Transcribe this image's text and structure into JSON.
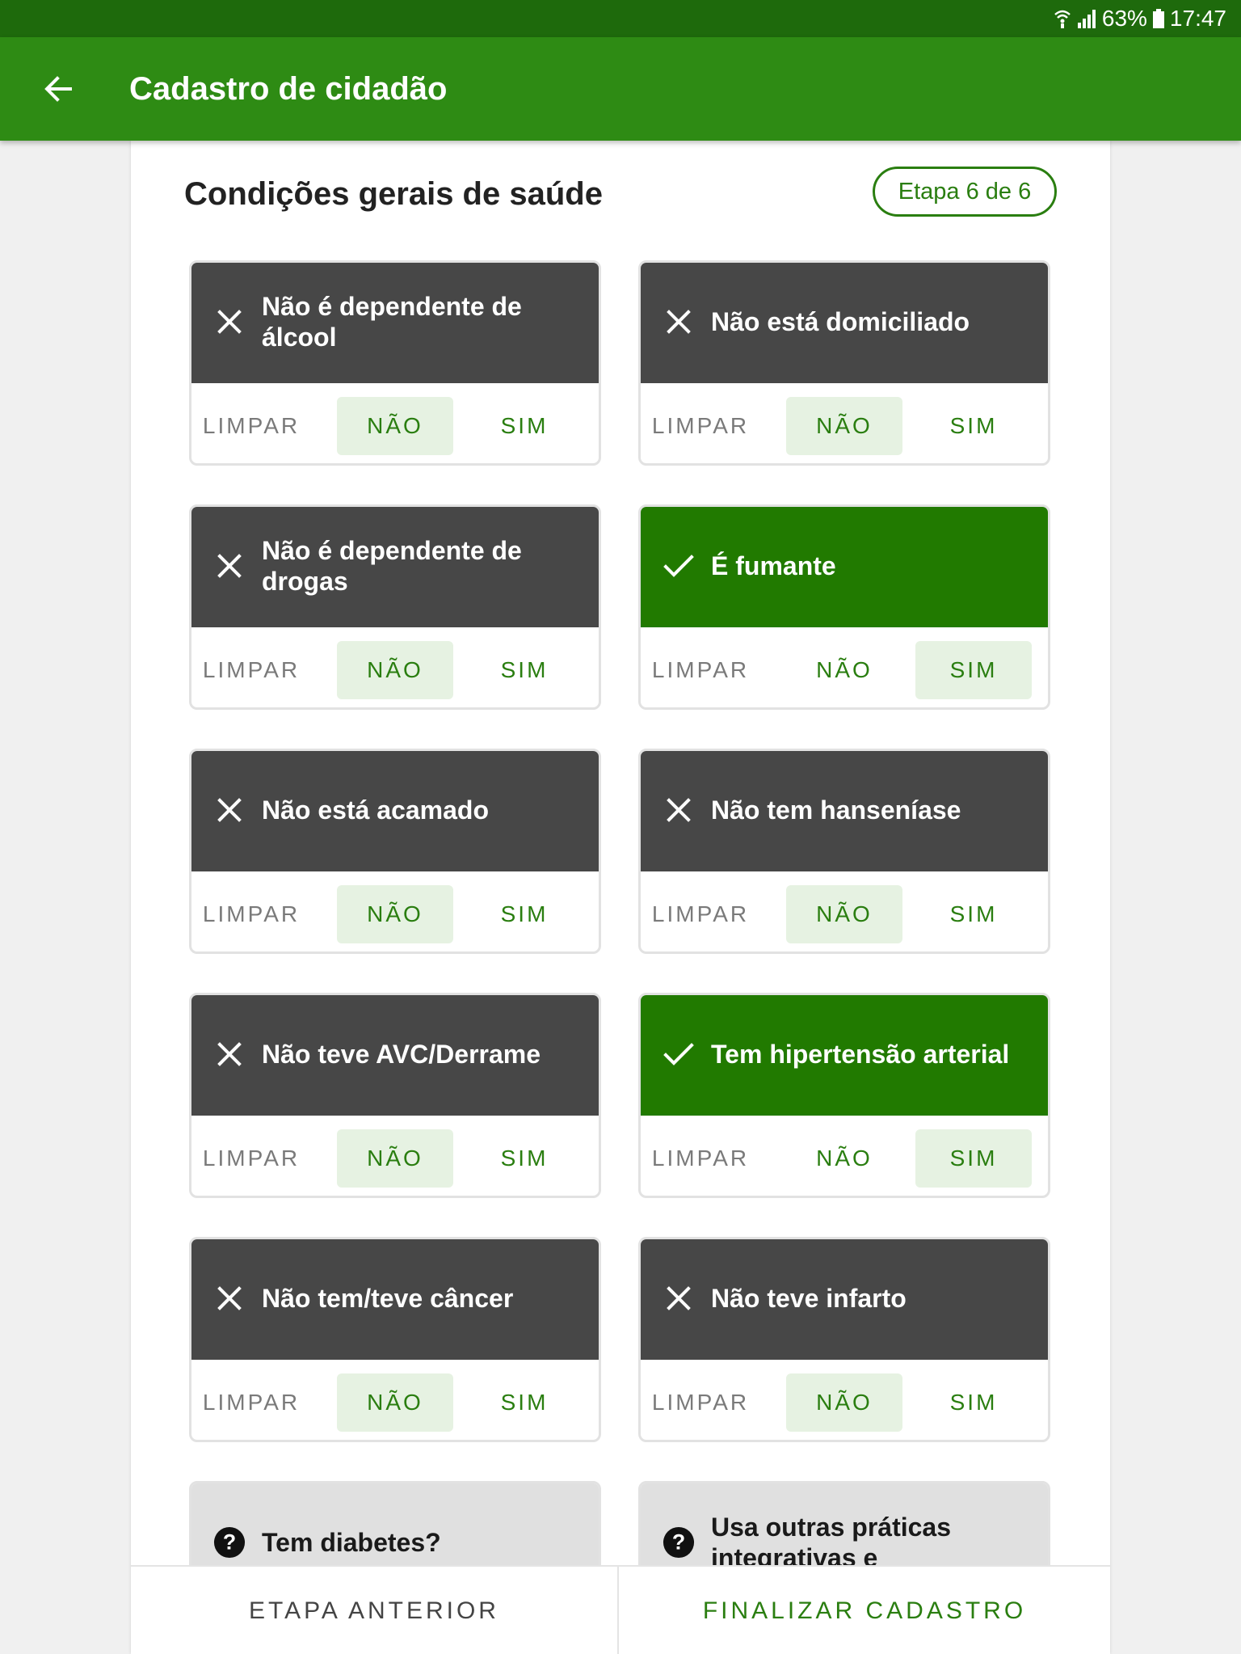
{
  "status_bar": {
    "battery": "63%",
    "time": "17:47"
  },
  "app_bar": {
    "title": "Cadastro de cidadão"
  },
  "section": {
    "title": "Condições gerais de saúde",
    "step": "Etapa 6 de 6"
  },
  "options": {
    "limpar": "LIMPAR",
    "nao": "NÃO",
    "sim": "SIM"
  },
  "cards": [
    {
      "label": "Não é dependente de álcool",
      "icon": "close-icon",
      "selected": "NÃO"
    },
    {
      "label": "Não está domiciliado",
      "icon": "close-icon",
      "selected": "NÃO"
    },
    {
      "label": "Não é dependente de drogas",
      "icon": "close-icon",
      "selected": "NÃO"
    },
    {
      "label": "É fumante",
      "icon": "check-icon",
      "selected": "SIM"
    },
    {
      "label": "Não está acamado",
      "icon": "close-icon",
      "selected": "NÃO"
    },
    {
      "label": "Não tem hanseníase",
      "icon": "close-icon",
      "selected": "NÃO"
    },
    {
      "label": "Não teve AVC/Derrame",
      "icon": "close-icon",
      "selected": "NÃO"
    },
    {
      "label": "Tem hipertensão arterial",
      "icon": "check-icon",
      "selected": "SIM"
    },
    {
      "label": "Não tem/teve câncer",
      "icon": "close-icon",
      "selected": "NÃO"
    },
    {
      "label": "Não teve infarto",
      "icon": "close-icon",
      "selected": "NÃO"
    },
    {
      "label": "Tem diabetes?",
      "icon": "help-icon",
      "selected": ""
    },
    {
      "label": "Usa outras práticas integrativas e",
      "icon": "help-icon",
      "selected": ""
    }
  ],
  "bottom": {
    "prev": "ETAPA ANTERIOR",
    "next": "FINALIZAR CADASTRO"
  },
  "colors": {
    "status_bar": "#1e6a0c",
    "app_bar": "#2e8b14",
    "negative": "#474747",
    "positive": "#217a00",
    "unknown": "#e0e0e0",
    "accent": "#2a7e10"
  }
}
